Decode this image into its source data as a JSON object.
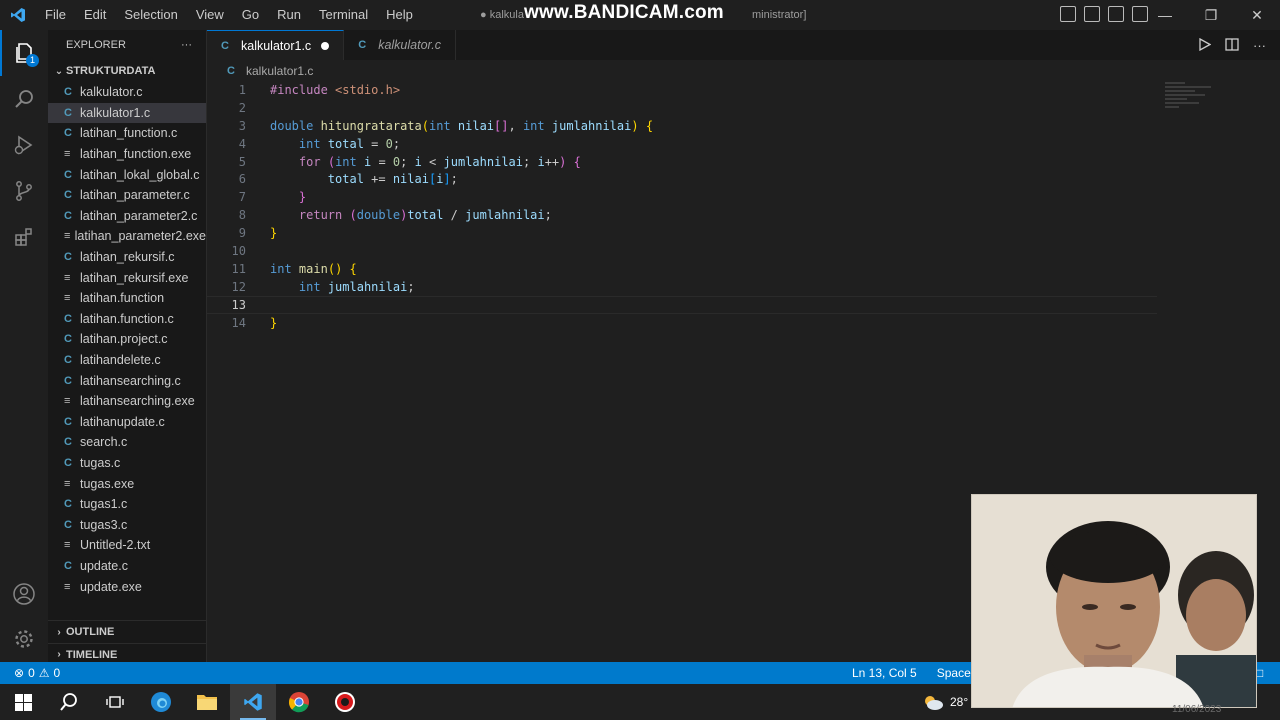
{
  "titlebar": {
    "menu": [
      "File",
      "Edit",
      "Selection",
      "View",
      "Go",
      "Run",
      "Terminal",
      "Help"
    ],
    "window_title": "● kalkula",
    "window_title_suffix": "ministrator]",
    "watermark": "www.BANDICAM.com"
  },
  "activity_bar": {
    "explorer_badge": "1",
    "icons": [
      "files-icon",
      "search-icon",
      "run-debug-icon",
      "source-control-icon",
      "extensions-icon",
      "account-icon",
      "settings-icon"
    ]
  },
  "sidebar": {
    "title": "EXPLORER",
    "more": "···",
    "folder": "STRUKTURDATA",
    "files": [
      {
        "name": "kalkulator.c",
        "type": "c"
      },
      {
        "name": "kalkulator1.c",
        "type": "c",
        "selected": true
      },
      {
        "name": "latihan_function.c",
        "type": "c"
      },
      {
        "name": "latihan_function.exe",
        "type": "other"
      },
      {
        "name": "latihan_lokal_global.c",
        "type": "c"
      },
      {
        "name": "latihan_parameter.c",
        "type": "c"
      },
      {
        "name": "latihan_parameter2.c",
        "type": "c"
      },
      {
        "name": "latihan_parameter2.exe",
        "type": "other"
      },
      {
        "name": "latihan_rekursif.c",
        "type": "c"
      },
      {
        "name": "latihan_rekursif.exe",
        "type": "other"
      },
      {
        "name": "latihan.function",
        "type": "other"
      },
      {
        "name": "latihan.function.c",
        "type": "c"
      },
      {
        "name": "latihan.project.c",
        "type": "c"
      },
      {
        "name": "latihandelete.c",
        "type": "c"
      },
      {
        "name": "latihansearching.c",
        "type": "c"
      },
      {
        "name": "latihansearching.exe",
        "type": "other"
      },
      {
        "name": "latihanupdate.c",
        "type": "c"
      },
      {
        "name": "search.c",
        "type": "c"
      },
      {
        "name": "tugas.c",
        "type": "c"
      },
      {
        "name": "tugas.exe",
        "type": "other"
      },
      {
        "name": "tugas1.c",
        "type": "c"
      },
      {
        "name": "tugas3.c",
        "type": "c"
      },
      {
        "name": "Untitled-2.txt",
        "type": "other"
      },
      {
        "name": "update.c",
        "type": "c"
      },
      {
        "name": "update.exe",
        "type": "other"
      }
    ],
    "sections": [
      "OUTLINE",
      "TIMELINE"
    ]
  },
  "tabs": [
    {
      "label": "kalkulator1.c",
      "active": true,
      "dirty": true
    },
    {
      "label": "kalkulator.c",
      "active": false
    }
  ],
  "file_icon_letter": "C",
  "breadcrumb": "kalkulator1.c",
  "editor": {
    "current_line": 13,
    "lines": [
      "#include <stdio.h>",
      "",
      "double hitungratarata(int nilai[], int jumlahnilai) {",
      "    int total = 0;",
      "    for (int i = 0; i < jumlahnilai; i++) {",
      "        total += nilai[i];",
      "    }",
      "    return (double)total / jumlahnilai;",
      "}",
      "",
      "int main() {",
      "    int jumlahnilai;",
      "",
      "}"
    ]
  },
  "statusbar": {
    "errors": "0",
    "warnings": "0",
    "position": "Ln 13, Col 5",
    "spaces": "Spaces: 4"
  },
  "taskbar": {
    "apps": [
      "windows-start-icon",
      "search-icon",
      "task-view-icon",
      "edge-icon",
      "file-explorer-icon",
      "vscode-icon",
      "chrome-icon",
      "bandicam-icon"
    ],
    "weather_temp": "28°",
    "date": "11/06/2023"
  },
  "colors": {
    "accent": "#0078d4",
    "statusbar": "#007acc",
    "editor_bg": "#1f1f1f",
    "sidebar_bg": "#181818"
  }
}
